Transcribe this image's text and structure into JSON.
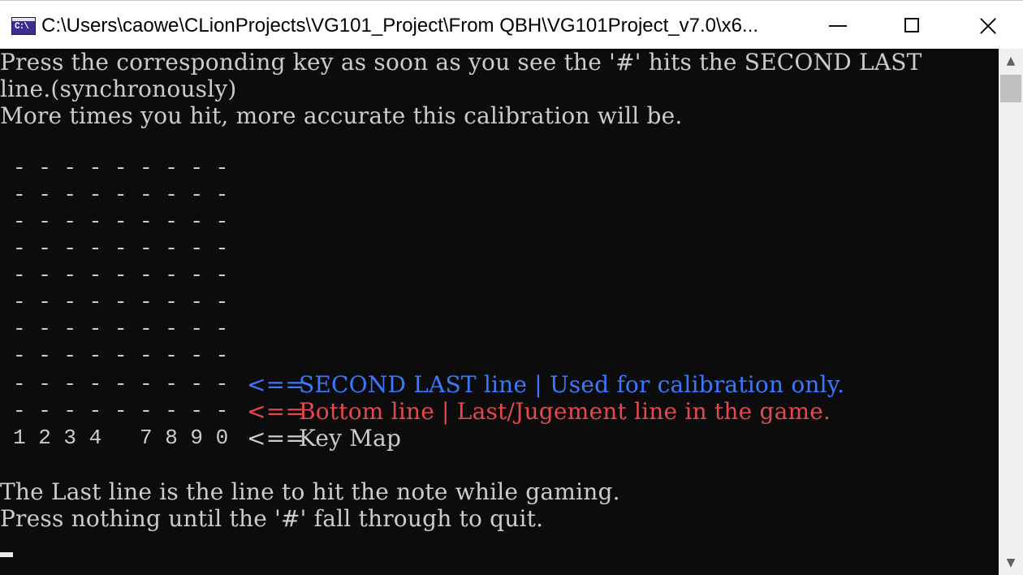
{
  "window": {
    "title": "C:\\Users\\caowe\\CLionProjects\\VG101_Project\\From QBH\\VG101Project_v7.0\\x6...",
    "icon_text": "C:\\",
    "icon": "console-app-icon",
    "controls": [
      "minimize-icon",
      "maximize-icon",
      "close-icon"
    ]
  },
  "console": {
    "instructions": [
      "Press the corresponding key as soon as you see the '#' hits the SECOND LAST",
      "line.(synchronously)",
      "More times you hit, more accurate this calibration will be."
    ],
    "grid_rows": [
      "- - - - - - - - -",
      "- - - - - - - - -",
      "- - - - - - - - -",
      "- - - - - - - - -",
      "- - - - - - - - -",
      "- - - - - - - - -",
      "- - - - - - - - -",
      "- - - - - - - - -"
    ],
    "second_last_row": {
      "dashes": "- - - - - - - - -",
      "arrow": "<==",
      "label": "SECOND LAST line | Used for calibration only.",
      "color": "#3a78ff"
    },
    "bottom_row": {
      "dashes": "- - - - - - - - -",
      "arrow": "<==",
      "label": "Bottom line | Last/Jugement line in the game.",
      "color": "#e5484d"
    },
    "key_map_row": {
      "keys": "1 2 3 4   7 8 9 0",
      "arrow": "<==",
      "label": "Key Map"
    },
    "footer": [
      "The Last line is the line to hit the note while gaming.",
      "Press nothing until the '#' fall through to quit."
    ]
  },
  "scrollbar": {
    "up_icon": "scroll-up-arrow-icon",
    "down_icon": "scroll-down-arrow-icon",
    "up_glyph": "▲",
    "down_glyph": "▼"
  }
}
